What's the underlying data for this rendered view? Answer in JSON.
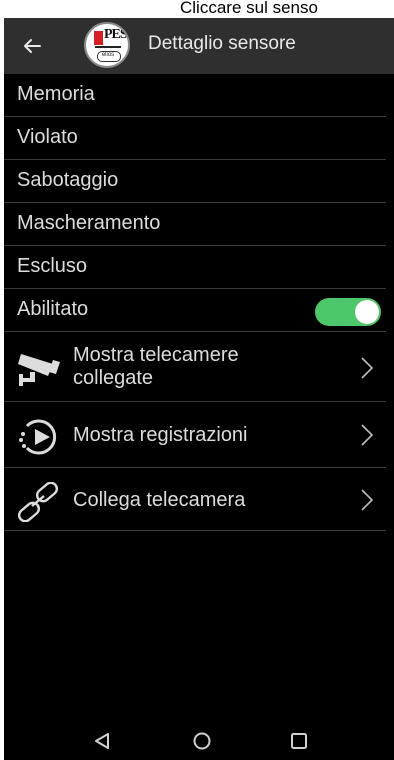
{
  "caption": "Cliccare sul senso",
  "appbar": {
    "title": "Dettaglio sensore",
    "logo_text": "PESS",
    "logo_subtext": "elios"
  },
  "states": [
    {
      "label": "Memoria"
    },
    {
      "label": "Violato"
    },
    {
      "label": "Sabotaggio"
    },
    {
      "label": "Mascheramento"
    },
    {
      "label": "Escluso"
    }
  ],
  "enabled": {
    "label": "Abilitato",
    "on": true,
    "color": "#4ec76a"
  },
  "actions": [
    {
      "line1": "Mostra telecamere",
      "line2": "collegate",
      "icon": "security-camera-icon"
    },
    {
      "label": "Mostra registrazioni",
      "icon": "playback-icon"
    },
    {
      "label": "Collega telecamera",
      "icon": "link-icon"
    }
  ],
  "system_nav": [
    "back-triangle-icon",
    "home-circle-icon",
    "recents-square-icon"
  ]
}
